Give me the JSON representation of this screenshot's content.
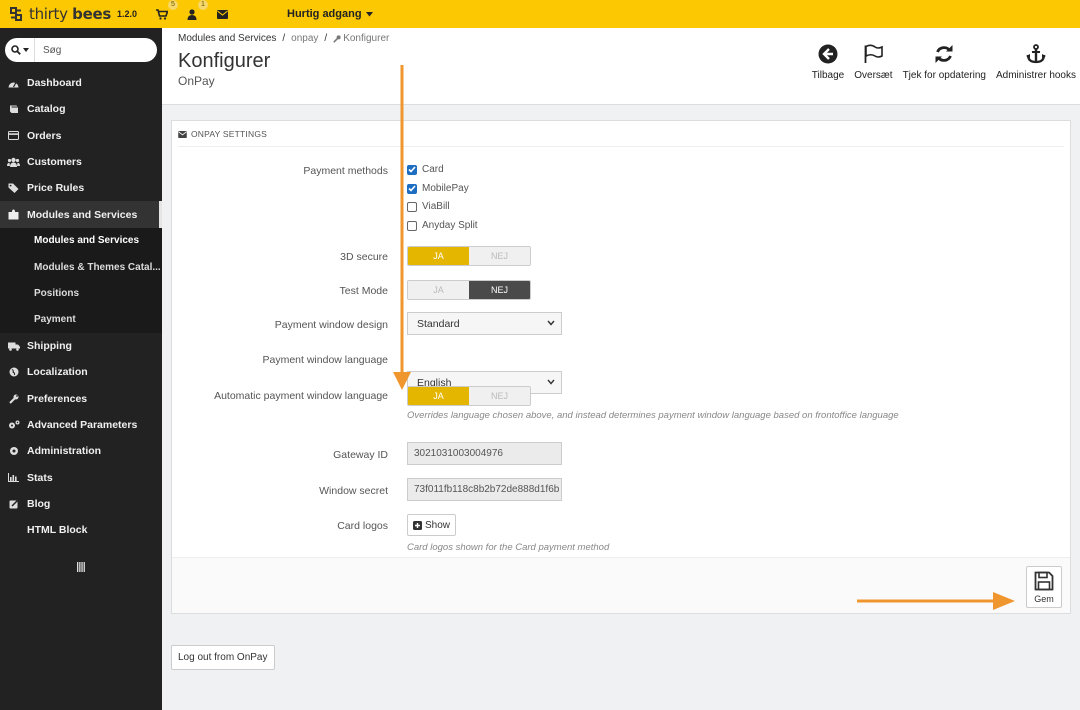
{
  "app": {
    "brand_light": "thirty",
    "brand_bold": "bees",
    "version": "1.2.0",
    "cart_badge": "5",
    "user_badge": "1",
    "quick_access": "Hurtig adgang",
    "accent_color": "#fbc802"
  },
  "sidebar": {
    "search_placeholder": "Søg",
    "items": [
      {
        "label": "Dashboard",
        "icon": "dashboard-icon"
      },
      {
        "label": "Catalog",
        "icon": "book-icon"
      },
      {
        "label": "Orders",
        "icon": "credit-card-icon"
      },
      {
        "label": "Customers",
        "icon": "users-icon"
      },
      {
        "label": "Price Rules",
        "icon": "tags-icon"
      },
      {
        "label": "Modules and Services",
        "icon": "puzzle-icon"
      }
    ],
    "subitems": [
      {
        "label": "Modules and Services"
      },
      {
        "label": "Modules & Themes Catal..."
      },
      {
        "label": "Positions"
      },
      {
        "label": "Payment"
      }
    ],
    "items_after": [
      {
        "label": "Shipping",
        "icon": "truck-icon"
      },
      {
        "label": "Localization",
        "icon": "globe-icon"
      },
      {
        "label": "Preferences",
        "icon": "wrench-icon"
      },
      {
        "label": "Advanced Parameters",
        "icon": "cogs-icon"
      },
      {
        "label": "Administration",
        "icon": "cog-icon"
      },
      {
        "label": "Stats",
        "icon": "bar-chart-icon"
      },
      {
        "label": "Blog",
        "icon": "edit-icon"
      },
      {
        "label": "HTML Block",
        "icon": ""
      }
    ]
  },
  "header": {
    "breadcrumb": [
      "Modules and Services",
      "onpay",
      "Konfigurer"
    ],
    "title": "Konfigurer",
    "subtitle": "OnPay",
    "toolbar": [
      {
        "label": "Tilbage",
        "icon": "arrow-left-circle-icon"
      },
      {
        "label": "Oversæt",
        "icon": "flag-icon"
      },
      {
        "label": "Tjek for opdatering",
        "icon": "refresh-icon"
      },
      {
        "label": "Administrer hooks",
        "icon": "anchor-icon"
      }
    ]
  },
  "panel": {
    "heading": "ONPAY SETTINGS",
    "payment_methods": {
      "label": "Payment methods",
      "options": [
        {
          "label": "Card",
          "checked": true
        },
        {
          "label": "MobilePay",
          "checked": true
        },
        {
          "label": "ViaBill",
          "checked": false
        },
        {
          "label": "Anyday Split",
          "checked": false
        }
      ]
    },
    "secure_3d": {
      "label": "3D secure",
      "yes": "JA",
      "no": "NEJ",
      "value": "JA"
    },
    "test_mode": {
      "label": "Test Mode",
      "yes": "JA",
      "no": "NEJ",
      "value": "NEJ"
    },
    "window_design": {
      "label": "Payment window design",
      "value": "Standard"
    },
    "window_language": {
      "label": "Payment window language",
      "value": "English"
    },
    "auto_language": {
      "label": "Automatic payment window language",
      "yes": "JA",
      "no": "NEJ",
      "value": "JA",
      "help": "Overrides language chosen above, and instead determines payment window language based on frontoffice language"
    },
    "gateway_id": {
      "label": "Gateway ID",
      "value": "3021031003004976"
    },
    "window_secret": {
      "label": "Window secret",
      "value": "73f011fb118c8b2b72de888d1f6b"
    },
    "card_logos": {
      "label": "Card logos",
      "button": "Show",
      "help": "Card logos shown for the Card payment method"
    },
    "save": "Gem"
  },
  "logout": "Log out from OnPay",
  "annotation_color": "#f0962e"
}
